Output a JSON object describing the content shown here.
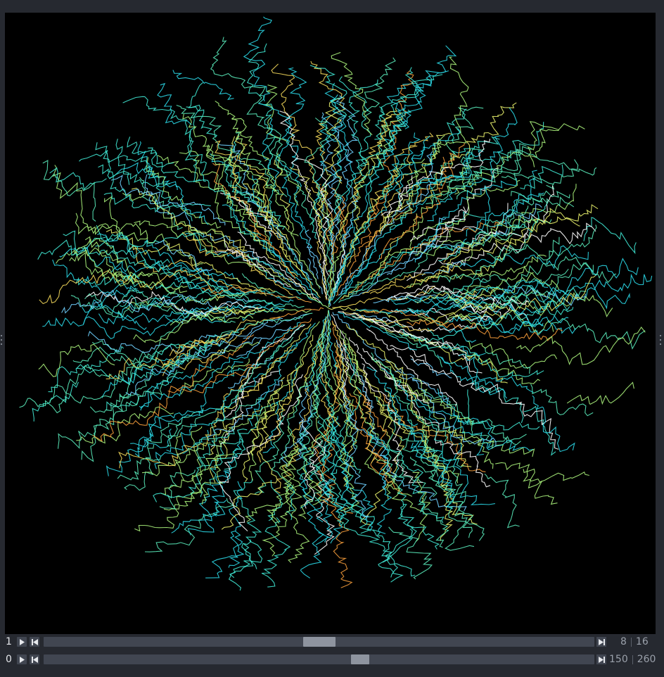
{
  "viewer": {
    "background": "#000000",
    "palette": [
      "#3fe6d2",
      "#2ad7e6",
      "#58e8b8",
      "#a8f07a",
      "#e6ee6a",
      "#f2d75a",
      "#ffffff",
      "#f29a3a",
      "#6fd0ff"
    ]
  },
  "dims": [
    {
      "axis_label": "1",
      "play_icon": "play-icon",
      "step_back_icon": "step-back-icon",
      "step_forward_icon": "step-forward-icon",
      "current": "8",
      "total": "16",
      "fraction": 0.5
    },
    {
      "axis_label": "0",
      "play_icon": "play-icon",
      "step_back_icon": "step-back-icon",
      "step_forward_icon": "step-forward-icon",
      "current": "150",
      "total": "260",
      "fraction": 0.577
    }
  ]
}
